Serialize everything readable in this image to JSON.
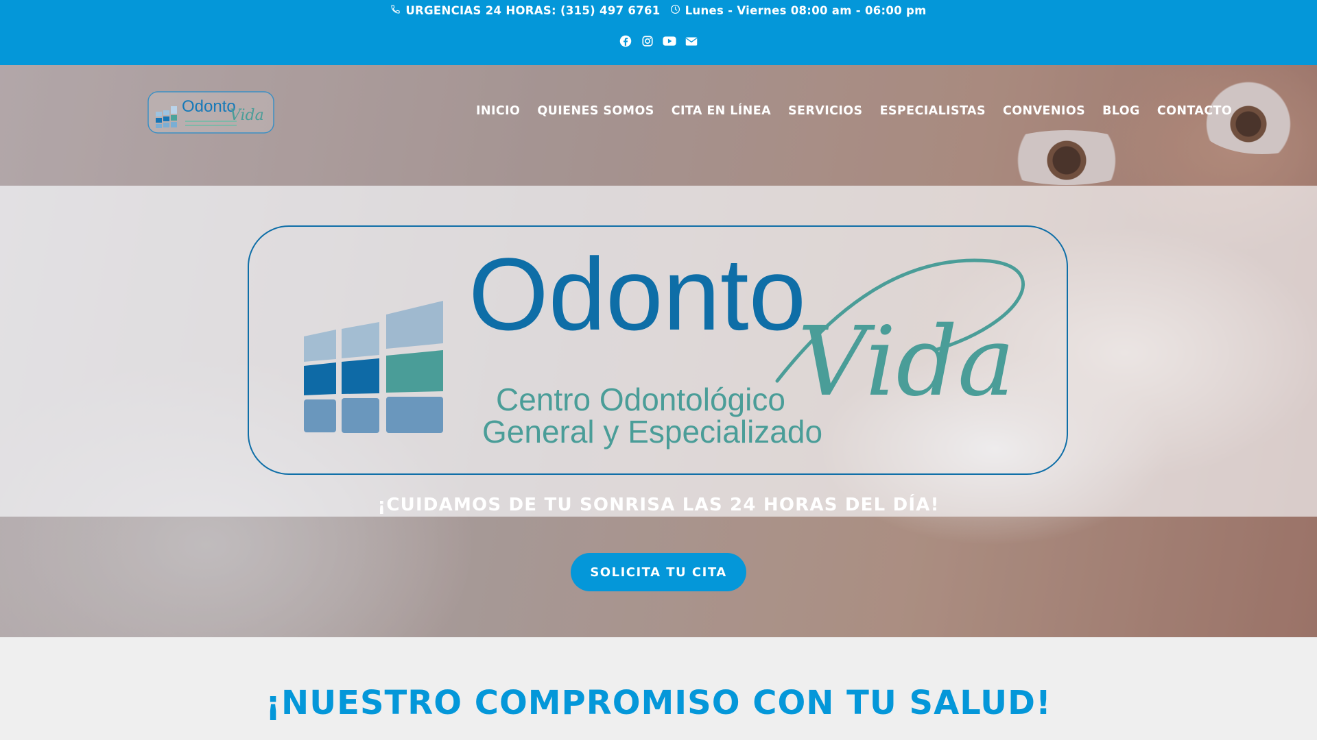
{
  "topbar": {
    "urgent_text": "URGENCIAS 24 HORAS: (315) 497 6761",
    "hours_text": "Lunes - Viernes 08:00 am - 06:00 pm",
    "social": [
      "facebook-icon",
      "instagram-icon",
      "youtube-icon",
      "envelope-icon"
    ],
    "background": "#0497d9"
  },
  "header": {
    "logo_alt": "OdontoVida",
    "nav": [
      {
        "label": "INICIO"
      },
      {
        "label": "QUIENES SOMOS"
      },
      {
        "label": "CITA EN LÍNEA"
      },
      {
        "label": "SERVICIOS"
      },
      {
        "label": "ESPECIALISTAS"
      },
      {
        "label": "CONVENIOS"
      },
      {
        "label": "BLOG"
      },
      {
        "label": "CONTACTO"
      }
    ]
  },
  "hero": {
    "logo": {
      "word1": "Odonto",
      "word2": "Vida",
      "line1": "Centro Odontológico",
      "line2": "General y Especializado"
    },
    "tagline": "¡CUIDAMOS DE TU SONRISA LAS 24 HORAS DEL DÍA!",
    "cta_label": "SOLICITA TU CITA"
  },
  "section": {
    "title": "¡NUESTRO COMPROMISO CON TU SALUD!"
  },
  "colors": {
    "accent": "#0497d9",
    "logo_blue": "#0e6ea7",
    "logo_teal": "#4a9d98"
  }
}
